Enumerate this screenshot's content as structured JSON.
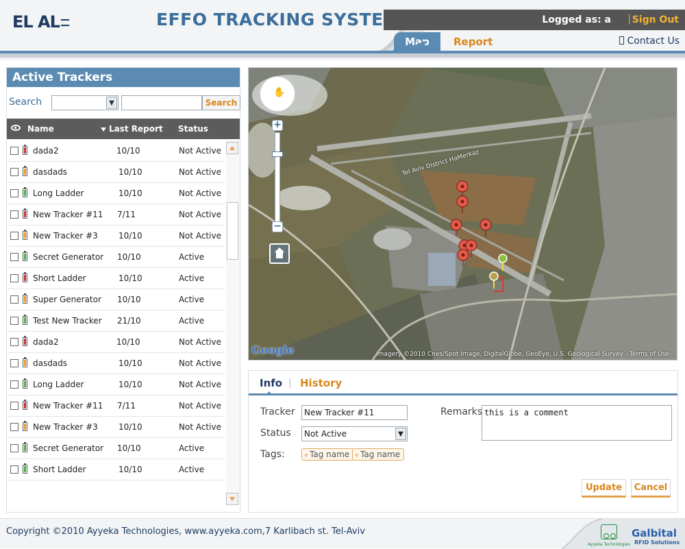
{
  "header": {
    "logo_text": "EL AL",
    "system_title": "EFFO TRACKING SYSTEM",
    "logged_as": "Logged as: a",
    "separator": "|",
    "sign_out": "Sign Out",
    "tabs": {
      "map": "Map",
      "report": "Report"
    },
    "contact_us": "Contact Us"
  },
  "left_panel": {
    "title": "Active Trackers",
    "search_label": "Search",
    "search_select_value": "",
    "search_input_value": "",
    "search_button": "Search",
    "columns": {
      "name": "Name",
      "last_report": "Last Report",
      "status": "Status"
    },
    "rows": [
      {
        "name": "dada2",
        "last_report": "10/10",
        "status": "Not Active",
        "battery_color": "#d12b2b"
      },
      {
        "name": "dasdads",
        "last_report": "10/10",
        "status": "Not Active",
        "battery_color": "#f19a1f"
      },
      {
        "name": "Long Ladder",
        "last_report": "10/10",
        "status": "Not Active",
        "battery_color": "#3bb83b"
      },
      {
        "name": "New Tracker #11",
        "last_report": "7/11",
        "status": "Not Active",
        "battery_color": "#d12b2b"
      },
      {
        "name": "New Tracker #3",
        "last_report": "10/10",
        "status": "Not Active",
        "battery_color": "#f19a1f"
      },
      {
        "name": "Secret Generator",
        "last_report": "10/10",
        "status": "Active",
        "battery_color": "#3bb83b"
      },
      {
        "name": "Short Ladder",
        "last_report": "10/10",
        "status": "Active",
        "battery_color": "#d12b2b"
      },
      {
        "name": "Super Generator",
        "last_report": "10/10",
        "status": "Active",
        "battery_color": "#f19a1f"
      },
      {
        "name": "Test New Tracker",
        "last_report": "21/10",
        "status": "Active",
        "battery_color": "#3bb83b"
      },
      {
        "name": "dada2",
        "last_report": "10/10",
        "status": "Not Active",
        "battery_color": "#d12b2b"
      },
      {
        "name": "dasdads",
        "last_report": "10/10",
        "status": "Not Active",
        "battery_color": "#f19a1f"
      },
      {
        "name": "Long Ladder",
        "last_report": "10/10",
        "status": "Not Active",
        "battery_color": "#3bb83b"
      },
      {
        "name": "New Tracker #11",
        "last_report": "7/11",
        "status": "Not Active",
        "battery_color": "#d12b2b"
      },
      {
        "name": "New Tracker #3",
        "last_report": "10/10",
        "status": "Not Active",
        "battery_color": "#f19a1f"
      },
      {
        "name": "Secret Generator",
        "last_report": "10/10",
        "status": "Active",
        "battery_color": "#3bb83b"
      },
      {
        "name": "Short Ladder",
        "last_report": "10/10",
        "status": "Active",
        "battery_color": "#3bb83b"
      }
    ]
  },
  "map": {
    "district_label": "Tel Aviv District HaMerkaz",
    "google_logo": "Google",
    "imagery_credit": "Imagery ©2010 Cnes/Spot Image, DigitalGlobe, GeoEye, U.S. Geological Survey - Terms of Use",
    "marker_color": "#e25a4a",
    "track_color": "#d93a2a"
  },
  "info_panel": {
    "tabs": {
      "info": "Info",
      "separator": "|",
      "history": "History"
    },
    "tracker_label": "Tracker",
    "tracker_value": "New Tracker #11",
    "status_label": "Status",
    "status_value": "Not Active",
    "tags_label": "Tags:",
    "tags": [
      "Tag name",
      "Tag name"
    ],
    "remarks_label": "Remarks",
    "remarks_value": "this is a comment",
    "update_button": "Update",
    "cancel_button": "Cancel"
  },
  "footer": {
    "copyright": "Copyright ©2010 Ayyeka Technologies, www.ayyeka.com,7 Karlibach st. Tel-Aviv",
    "partner1": "Ayyeka Technologies",
    "partner2": "Galbital",
    "partner2_sub": "RFID Solutions"
  }
}
